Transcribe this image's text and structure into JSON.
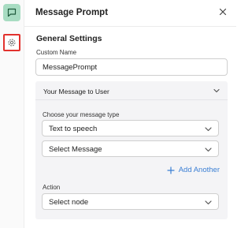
{
  "sidebar": {
    "message_icon": "message-square-icon",
    "settings_icon": "gear-icon"
  },
  "header": {
    "title": "Message Prompt",
    "close_icon": "close-icon"
  },
  "general": {
    "section_title": "General Settings",
    "custom_name_label": "Custom Name",
    "custom_name_value": "MessagePrompt"
  },
  "message_panel": {
    "title": "Your Message to User",
    "type_label": "Choose your message type",
    "type_value": "Text to speech",
    "message_value": "Select Message",
    "add_another_label": "Add Another",
    "action_label": "Action",
    "action_value": "Select node"
  },
  "colors": {
    "accent_green": "#a8dcc2",
    "highlight_red": "#e2322e",
    "link_blue": "#3b7fd4"
  }
}
